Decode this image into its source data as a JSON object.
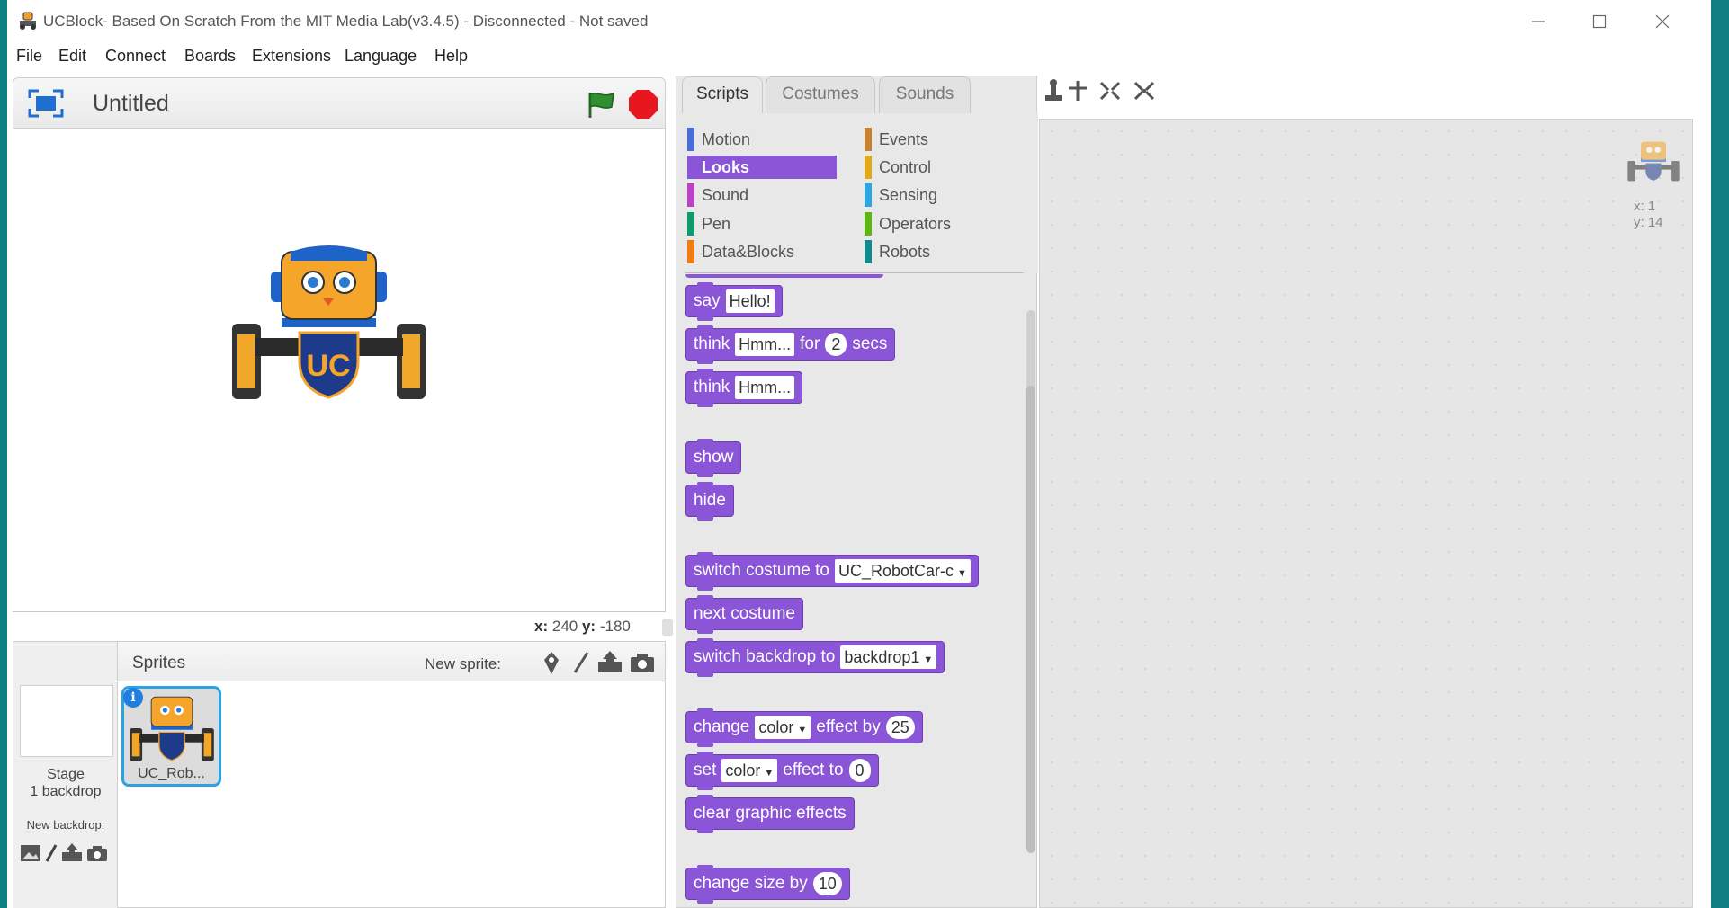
{
  "window": {
    "title": "UCBlock- Based On Scratch From the MIT Media Lab(v3.4.5) - Disconnected - Not saved",
    "controls": [
      "minimize-icon",
      "maximize-icon",
      "close-icon"
    ]
  },
  "menu": [
    "File",
    "Edit",
    "Connect",
    "Boards",
    "Extensions",
    "Language",
    "Help"
  ],
  "stage": {
    "project_title": "Untitled",
    "coords": {
      "x_label": "x:",
      "x": "240",
      "y_label": "y:",
      "y": "-180"
    }
  },
  "sprites": {
    "header": "Sprites",
    "new_sprite_label": "New sprite:",
    "tiles": [
      {
        "name": "UC_Rob..."
      }
    ],
    "stage_label": "Stage",
    "backdrop_count": "1 backdrop",
    "new_backdrop_label": "New backdrop:"
  },
  "tabs": [
    "Scripts",
    "Costumes",
    "Sounds"
  ],
  "categories": {
    "left": [
      {
        "label": "Motion",
        "color": "#4a6cd4"
      },
      {
        "label": "Looks",
        "color": "#8a55d7",
        "active": true
      },
      {
        "label": "Sound",
        "color": "#bb42c3"
      },
      {
        "label": "Pen",
        "color": "#0e9a6c"
      },
      {
        "label": "Data&Blocks",
        "color": "#ee7d16"
      }
    ],
    "right": [
      {
        "label": "Events",
        "color": "#c88330"
      },
      {
        "label": "Control",
        "color": "#e1a91a"
      },
      {
        "label": "Sensing",
        "color": "#2ca5e2"
      },
      {
        "label": "Operators",
        "color": "#5cb712"
      },
      {
        "label": "Robots",
        "color": "#0f8a8d"
      }
    ]
  },
  "blocks": {
    "say": {
      "word": "say",
      "text": "Hello!"
    },
    "think_for": {
      "word": "think",
      "text": "Hmm...",
      "for": "for",
      "secs_value": "2",
      "secs": "secs"
    },
    "think": {
      "word": "think",
      "text": "Hmm..."
    },
    "show": "show",
    "hide": "hide",
    "switch_costume": {
      "label": "switch costume to",
      "value": "UC_RobotCar-c"
    },
    "next_costume": "next costume",
    "switch_backdrop": {
      "label": "switch backdrop to",
      "value": "backdrop1"
    },
    "change_effect": {
      "word": "change",
      "effect": "color",
      "by": "effect by",
      "value": "25"
    },
    "set_effect": {
      "word": "set",
      "effect": "color",
      "to": "effect to",
      "value": "0"
    },
    "clear_effects": "clear graphic effects",
    "change_size": {
      "label": "change size by",
      "value": "10"
    }
  },
  "script_area": {
    "x_label": "x:",
    "x": "1",
    "y_label": "y:",
    "y": "14"
  },
  "colors": {
    "looks": "#8a55d7",
    "accent_blue": "#2aa3e3",
    "desktop": "#0f7f83"
  }
}
